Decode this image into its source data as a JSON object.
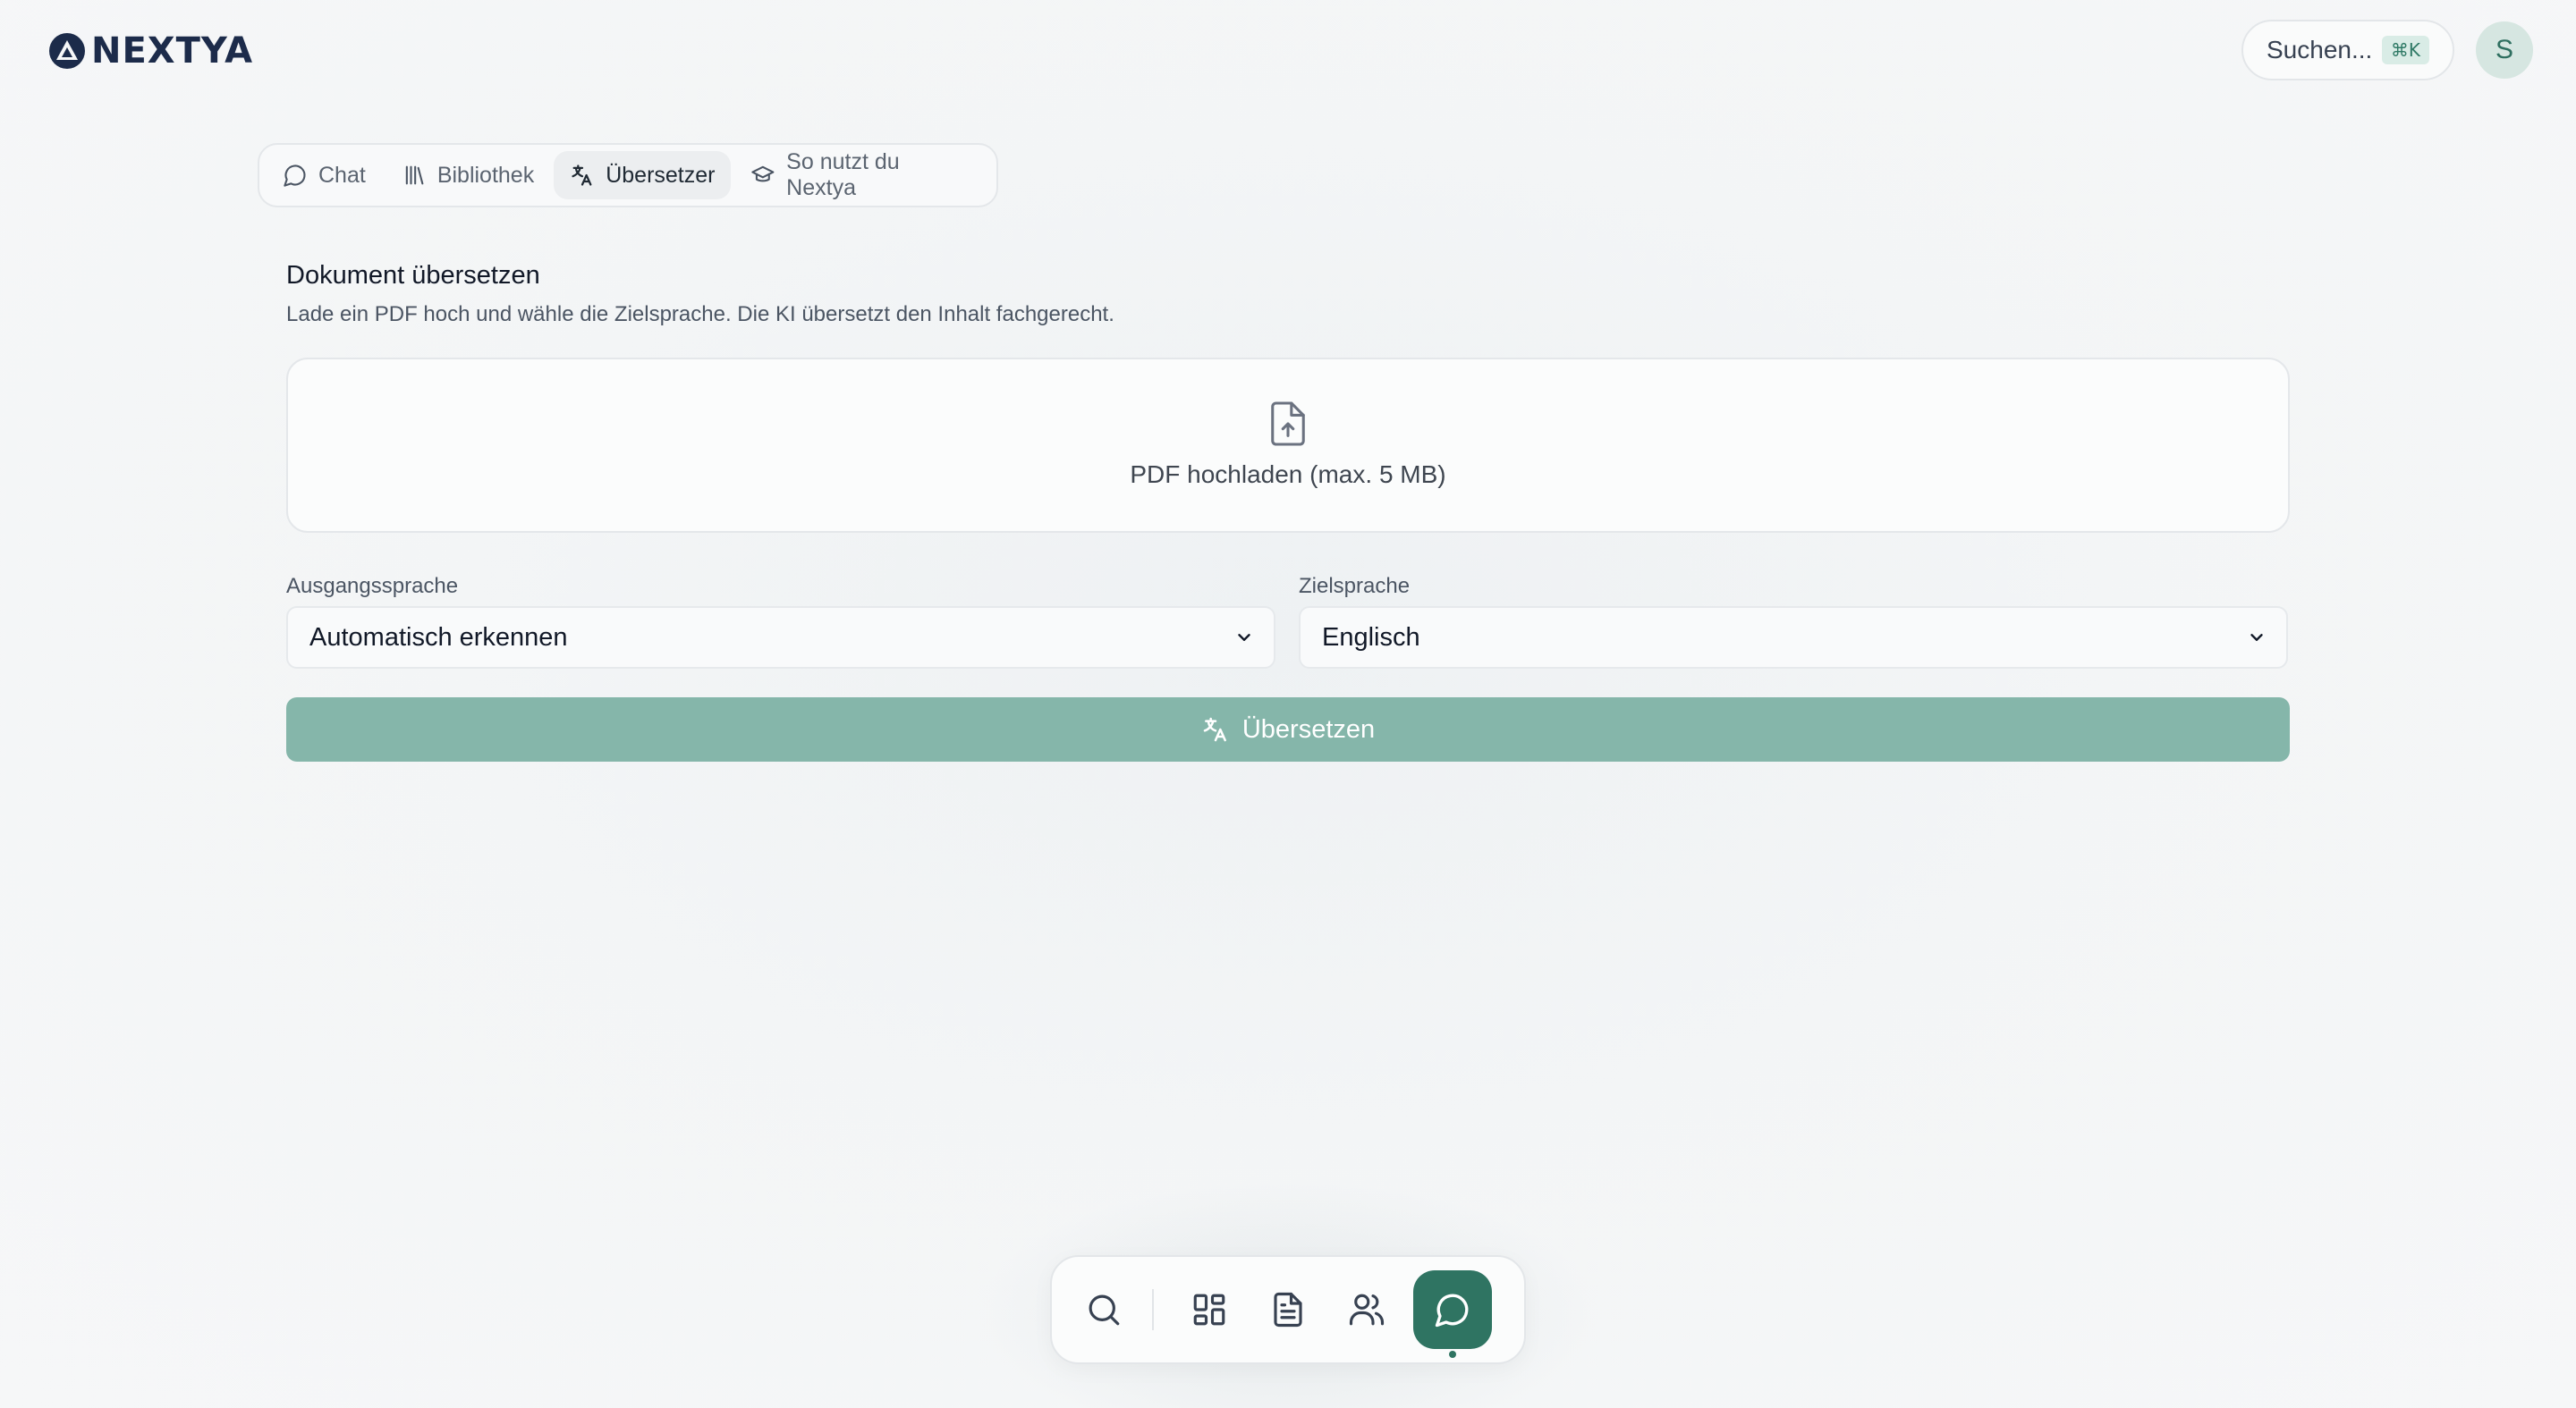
{
  "brand": {
    "name": "NEXTYA"
  },
  "header": {
    "search_label": "Suchen...",
    "search_shortcut": "⌘K",
    "avatar_initial": "S"
  },
  "tabs": [
    {
      "label": "Chat",
      "icon": "chat-bubble-icon",
      "active": false
    },
    {
      "label": "Bibliothek",
      "icon": "library-icon",
      "active": false
    },
    {
      "label": "Übersetzer",
      "icon": "translate-icon",
      "active": true
    },
    {
      "label": "So nutzt du Nextya",
      "icon": "graduation-cap-icon",
      "active": false
    }
  ],
  "section": {
    "title": "Dokument übersetzen",
    "subtitle": "Lade ein PDF hoch und wähle die Zielsprache. Die KI übersetzt den Inhalt fachgerecht.",
    "upload_label": "PDF hochladen (max. 5 MB)"
  },
  "source_language": {
    "label": "Ausgangssprache",
    "value": "Automatisch erkennen"
  },
  "target_language": {
    "label": "Zielsprache",
    "value": "Englisch"
  },
  "translate_button": {
    "label": "Übersetzen"
  },
  "dock": {
    "items": [
      "search-icon",
      "grid-icon",
      "document-icon",
      "users-icon",
      "chat-icon"
    ],
    "active": "chat-icon"
  },
  "colors": {
    "accent": "#2f7462",
    "button_disabled": "#85b6aa",
    "brand": "#1c2b4a"
  }
}
